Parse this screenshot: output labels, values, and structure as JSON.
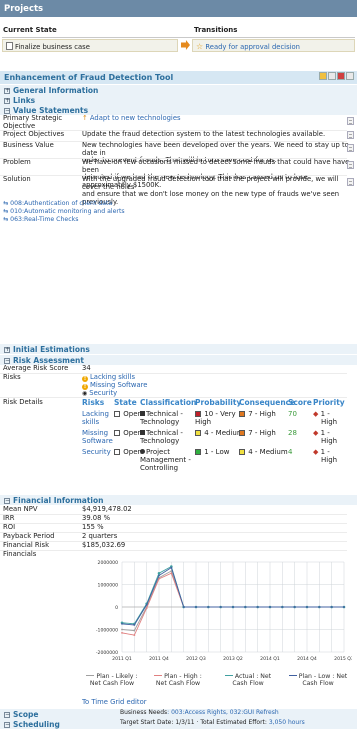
{
  "header": {
    "title": "Projects"
  },
  "state": {
    "current_label": "Current State",
    "current": "Finalize business case",
    "trans_label": "Transitions",
    "transition": "Ready for approval decision"
  },
  "project": {
    "title": "Enhancement of Fraud Detection Tool"
  },
  "sections": {
    "general": "General Information",
    "links": "Links",
    "value": "Value Statements",
    "estimations": "Initial Estimations",
    "risk": "Risk Assessment",
    "financial": "Financial Information",
    "scope": "Scope",
    "scheduling": "Scheduling"
  },
  "value": {
    "strategic_label": "Primary Strategic Objective",
    "strategic": "Adapt to new technologies",
    "objectives_label": "Project Objectives",
    "objectives": "Update the fraud detection system to the latest technologies available.",
    "bv_label": "Business Value",
    "bv_l1": "New technologies have been developed over the years. We need to stay up to date in",
    "bv_l2": "order to prevent frauds. That will in turn save cost for us.",
    "prob_label": "Problem",
    "prob_l1": "We have on few occasions missed to detect some frauds that could have have been",
    "prob_l2": "detected if we had the new technology. This has caused us to lose approximately $1500K.",
    "sol_label": "Solution",
    "sol_l1": "With the upgraded fraud detection tool that the project will provide, we will cover the holes",
    "sol_l2": "and ensure that we don't lose money on the new type of frauds we've seen previously."
  },
  "risk": {
    "avg_label": "Average Risk Score",
    "avg": "34",
    "risks_label": "Risks",
    "risks": [
      "Lacking skills",
      "Missing Software",
      "Security"
    ],
    "details_label": "Risk Details",
    "headers": [
      "Risks",
      "State",
      "Classification",
      "Probability",
      "Consequence",
      "Score",
      "Priority"
    ],
    "rows": [
      {
        "risk_l1": "Lacking",
        "risk_l2": "skills",
        "state": "Open",
        "class_l1": "Technical -",
        "class_l2": "Technology",
        "class_l3": "",
        "prob_l1": "10 - Very",
        "prob_l2": "High",
        "prob_color": "#c0202a",
        "cons": "7 - High",
        "cons_color": "#e07820",
        "score": "70",
        "pri_l1": "1 -",
        "pri_l2": "High"
      },
      {
        "risk_l1": "Missing",
        "risk_l2": "Software",
        "state": "Open",
        "class_l1": "Technical -",
        "class_l2": "Technology",
        "class_l3": "",
        "prob_l1": "4 - Medium",
        "prob_l2": "",
        "prob_color": "#f0e040",
        "cons": "7 - High",
        "cons_color": "#e07820",
        "score": "28",
        "pri_l1": "1 -",
        "pri_l2": "High"
      },
      {
        "risk_l1": "Security",
        "risk_l2": "",
        "state": "Open",
        "class_l1": "Project",
        "class_l2": "Management -",
        "class_l3": "Controlling",
        "prob_l1": "1 - Low",
        "prob_l2": "",
        "prob_color": "#30b040",
        "cons": "4 - Medium",
        "cons_color": "#f0e040",
        "score": "4",
        "pri_l1": "1 -",
        "pri_l2": "High"
      }
    ]
  },
  "financial": {
    "npv_label": "Mean NPV",
    "npv": "$4,919,478.02",
    "irr_label": "IRR",
    "irr": "39.08 %",
    "roi_label": "ROI",
    "roi": "155 %",
    "payback_label": "Payback Period",
    "payback": "2 quarters",
    "risk_label": "Financial Risk",
    "risk": "$185,032.69",
    "fin_label": "Financials",
    "editor_link": "To Time Grid editor"
  },
  "chart_data": {
    "type": "line",
    "categories": [
      "2011 Q1",
      "2011 Q2",
      "2011 Q3",
      "2011 Q4",
      "2012 Q1",
      "2012 Q2",
      "2012 Q3",
      "2012 Q4",
      "2013 Q1",
      "2013 Q2",
      "2013 Q3",
      "2013 Q4",
      "2014 Q1",
      "2014 Q2",
      "2014 Q3",
      "2014 Q4",
      "2015 Q1",
      "2015 Q2",
      "2015 Q3"
    ],
    "xticks": [
      "2011 Q1",
      "2011 Q4",
      "2012 Q3",
      "2013 Q2",
      "2014 Q1",
      "2014 Q4",
      "2015 Q3"
    ],
    "yticks": [
      "2000000",
      "1000000",
      "0",
      "-1000000",
      "-2000000"
    ],
    "ylim": [
      -2000000,
      2000000
    ],
    "series": [
      {
        "name": "Plan - Likely : Net Cash Flow",
        "color": "#a0a0a0",
        "values": [
          -1000000,
          -1050000,
          0,
          1300000,
          1600000,
          0,
          0,
          0,
          0,
          0,
          0,
          0,
          0,
          0,
          0,
          0,
          0,
          0,
          0
        ]
      },
      {
        "name": "Plan - High : Net Cash Flow",
        "color": "#e08080",
        "values": [
          -1150000,
          -1250000,
          -50000,
          1250000,
          1500000,
          0,
          0,
          0,
          0,
          0,
          0,
          0,
          0,
          0,
          0,
          0,
          0,
          0,
          0
        ]
      },
      {
        "name": "Actual : Net Cash Flow",
        "color": "#40a0a0",
        "values": [
          -700000,
          -750000,
          150000,
          1500000,
          1800000,
          0,
          0,
          0,
          0,
          0,
          0,
          0,
          0,
          0,
          0,
          0,
          0,
          0,
          0
        ]
      },
      {
        "name": "Plan - Low : Net Cash Flow",
        "color": "#4060a0",
        "values": [
          -750000,
          -800000,
          100000,
          1400000,
          1750000,
          0,
          0,
          0,
          0,
          0,
          0,
          0,
          0,
          0,
          0,
          0,
          0,
          0,
          0
        ]
      }
    ]
  },
  "scope": {
    "needs_label": "Business Needs",
    "needs": [
      "003:Access Rights",
      "008:Authentication of client data",
      "010:Automatic monitoring and alerts",
      "032:GUI Refresh",
      "063:Real-Time Checks"
    ],
    "effort_label": "Total Estimated Effort",
    "effort": "3,050 hours"
  },
  "scheduling": {
    "start_label": "Target Start Date",
    "start": "1/3/11"
  }
}
